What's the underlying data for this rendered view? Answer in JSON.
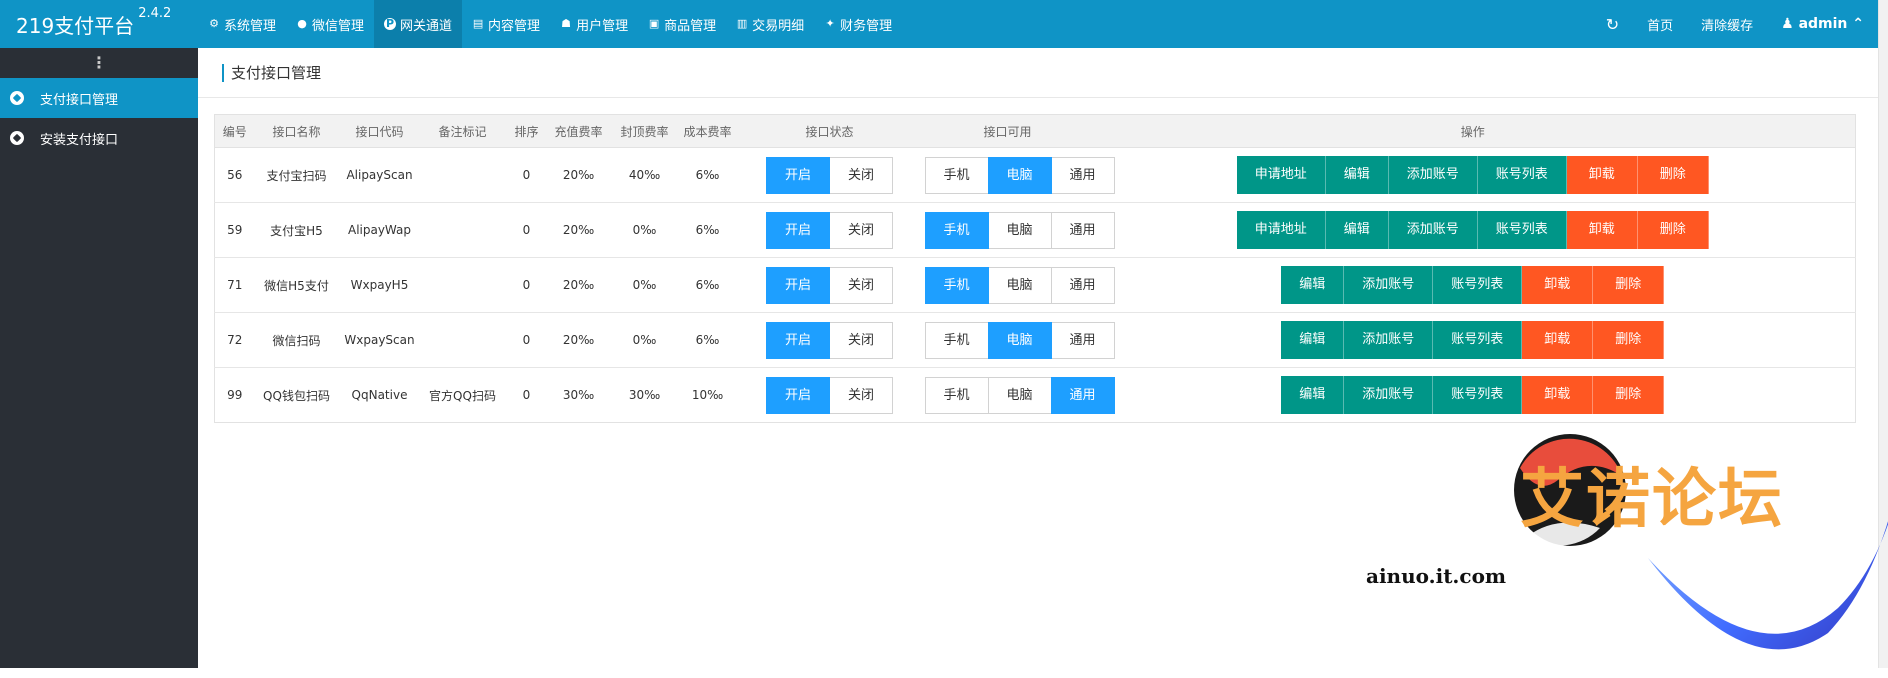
{
  "app": {
    "name": "219支付平台",
    "version": "2.4.2"
  },
  "topnav": [
    {
      "label": "系统管理",
      "icon": "gear-icon",
      "glyph": "⚙",
      "active": false
    },
    {
      "label": "微信管理",
      "icon": "wechat-icon",
      "glyph": "●",
      "active": false
    },
    {
      "label": "网关通道",
      "icon": "gateway-pin-icon",
      "glyph": "P",
      "active": true
    },
    {
      "label": "内容管理",
      "icon": "document-icon",
      "glyph": "▤",
      "active": false
    },
    {
      "label": "用户管理",
      "icon": "users-icon",
      "glyph": "☗",
      "active": false
    },
    {
      "label": "商品管理",
      "icon": "shopping-bag-icon",
      "glyph": "▣",
      "active": false
    },
    {
      "label": "交易明细",
      "icon": "bar-chart-icon",
      "glyph": "▥",
      "active": false
    },
    {
      "label": "财务管理",
      "icon": "money-icon",
      "glyph": "✦",
      "active": false
    }
  ],
  "topright": {
    "refresh_icon": "refresh-icon",
    "home": "首页",
    "clear_cache": "清除缓存",
    "user": "admin"
  },
  "sidebar": {
    "toggle_glyph": "⋮",
    "items": [
      {
        "label": "支付接口管理",
        "icon": "soccer-ball-icon",
        "active": true
      },
      {
        "label": "安装支付接口",
        "icon": "soccer-ball-icon",
        "active": false
      }
    ]
  },
  "page": {
    "title": "支付接口管理"
  },
  "table": {
    "headers": [
      "编号",
      "接口名称",
      "接口代码",
      "备注标记",
      "排序",
      "充值费率",
      "封顶费率",
      "成本费率",
      "接口状态",
      "接口可用",
      "操作"
    ],
    "status_labels": [
      "开启",
      "关闭"
    ],
    "device_labels": [
      "手机",
      "电脑",
      "通用"
    ],
    "rows": [
      {
        "id": "56",
        "name": "支付宝扫码",
        "code": "AlipayScan",
        "remark": "",
        "sort": "0",
        "rate": "20‰",
        "cap": "40‰",
        "cost": "6‰",
        "status": "开启",
        "device": "电脑",
        "actions": [
          {
            "label": "申请地址",
            "type": "g"
          },
          {
            "label": "编辑",
            "type": "g"
          },
          {
            "label": "添加账号",
            "type": "g"
          },
          {
            "label": "账号列表",
            "type": "g"
          },
          {
            "label": "卸载",
            "type": "r"
          },
          {
            "label": "删除",
            "type": "r"
          }
        ]
      },
      {
        "id": "59",
        "name": "支付宝H5",
        "code": "AlipayWap",
        "remark": "",
        "sort": "0",
        "rate": "20‰",
        "cap": "0‰",
        "cost": "6‰",
        "status": "开启",
        "device": "手机",
        "actions": [
          {
            "label": "申请地址",
            "type": "g"
          },
          {
            "label": "编辑",
            "type": "g"
          },
          {
            "label": "添加账号",
            "type": "g"
          },
          {
            "label": "账号列表",
            "type": "g"
          },
          {
            "label": "卸载",
            "type": "r"
          },
          {
            "label": "删除",
            "type": "r"
          }
        ]
      },
      {
        "id": "71",
        "name": "微信H5支付",
        "code": "WxpayH5",
        "remark": "",
        "sort": "0",
        "rate": "20‰",
        "cap": "0‰",
        "cost": "6‰",
        "status": "开启",
        "device": "手机",
        "actions": [
          {
            "label": "编辑",
            "type": "g"
          },
          {
            "label": "添加账号",
            "type": "g"
          },
          {
            "label": "账号列表",
            "type": "g"
          },
          {
            "label": "卸载",
            "type": "r"
          },
          {
            "label": "删除",
            "type": "r"
          }
        ]
      },
      {
        "id": "72",
        "name": "微信扫码",
        "code": "WxpayScan",
        "remark": "",
        "sort": "0",
        "rate": "20‰",
        "cap": "0‰",
        "cost": "6‰",
        "status": "开启",
        "device": "电脑",
        "actions": [
          {
            "label": "编辑",
            "type": "g"
          },
          {
            "label": "添加账号",
            "type": "g"
          },
          {
            "label": "账号列表",
            "type": "g"
          },
          {
            "label": "卸载",
            "type": "r"
          },
          {
            "label": "删除",
            "type": "r"
          }
        ]
      },
      {
        "id": "99",
        "name": "QQ钱包扫码",
        "code": "QqNative",
        "remark": "官方QQ扫码",
        "sort": "0",
        "rate": "30‰",
        "cap": "30‰",
        "cost": "10‰",
        "status": "开启",
        "device": "通用",
        "actions": [
          {
            "label": "编辑",
            "type": "g"
          },
          {
            "label": "添加账号",
            "type": "g"
          },
          {
            "label": "账号列表",
            "type": "g"
          },
          {
            "label": "卸载",
            "type": "r"
          },
          {
            "label": "删除",
            "type": "r"
          }
        ]
      }
    ]
  },
  "watermark": {
    "title": "艾诺论坛",
    "url": "ainuo.it.com"
  },
  "colors": {
    "topbar": "#0f94c6",
    "sidebar": "#2a2f36",
    "toggle_on": "#1e9fff",
    "btn_green": "#009688",
    "btn_red": "#ff5722"
  }
}
